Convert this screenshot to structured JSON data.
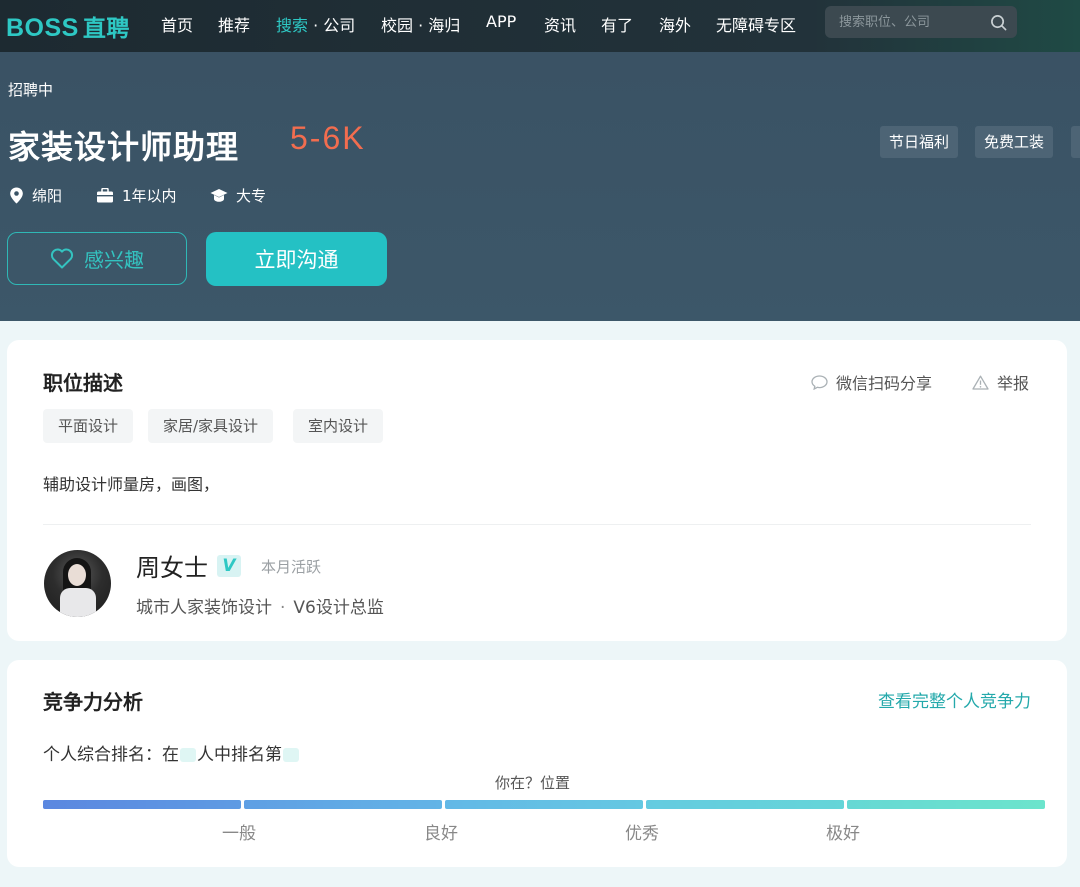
{
  "nav": {
    "logo_en": "BOSS",
    "logo_cn": "直聘",
    "items": [
      {
        "label": "首页"
      },
      {
        "label": "推荐"
      },
      {
        "label_hl": "搜索",
        "label_rest": " · 公司"
      },
      {
        "label": "校园 · 海归"
      },
      {
        "label": "APP"
      },
      {
        "label": "资讯"
      },
      {
        "label": "有了"
      },
      {
        "label": "海外"
      },
      {
        "label": "无障碍专区"
      }
    ],
    "search_placeholder": "搜索职位、公司",
    "search_icon": "search-icon"
  },
  "job": {
    "status": "招聘中",
    "title": "家装设计师助理",
    "salary": "5-6K",
    "benefits": [
      "节日福利",
      "免费工装"
    ],
    "location": "绵阳",
    "experience": "1年以内",
    "education": "大专",
    "interest_label": "感兴趣",
    "chat_label": "立即沟通"
  },
  "description": {
    "heading": "职位描述",
    "share_label": "微信扫码分享",
    "report_label": "举报",
    "tags": [
      "平面设计",
      "家居/家具设计",
      "室内设计"
    ],
    "text": "辅助设计师量房，画图，"
  },
  "recruiter": {
    "name": "周女士",
    "verified_badge": "V",
    "activity": "本月活跃",
    "company": "城市人家装饰设计",
    "position": "V6设计总监"
  },
  "competition": {
    "heading": "竞争力分析",
    "view_full": "查看完整个人竞争力",
    "rank_prefix": "个人综合排名：在",
    "rank_middle": "人中排名第",
    "you_label": "你在？位置",
    "levels": [
      "一般",
      "良好",
      "优秀",
      "极好"
    ]
  },
  "colors": {
    "accent": "#2ec8c4",
    "salary": "#f26d4f",
    "hero_bg": "#3b5466",
    "nav_bg": "#1f2b33"
  }
}
